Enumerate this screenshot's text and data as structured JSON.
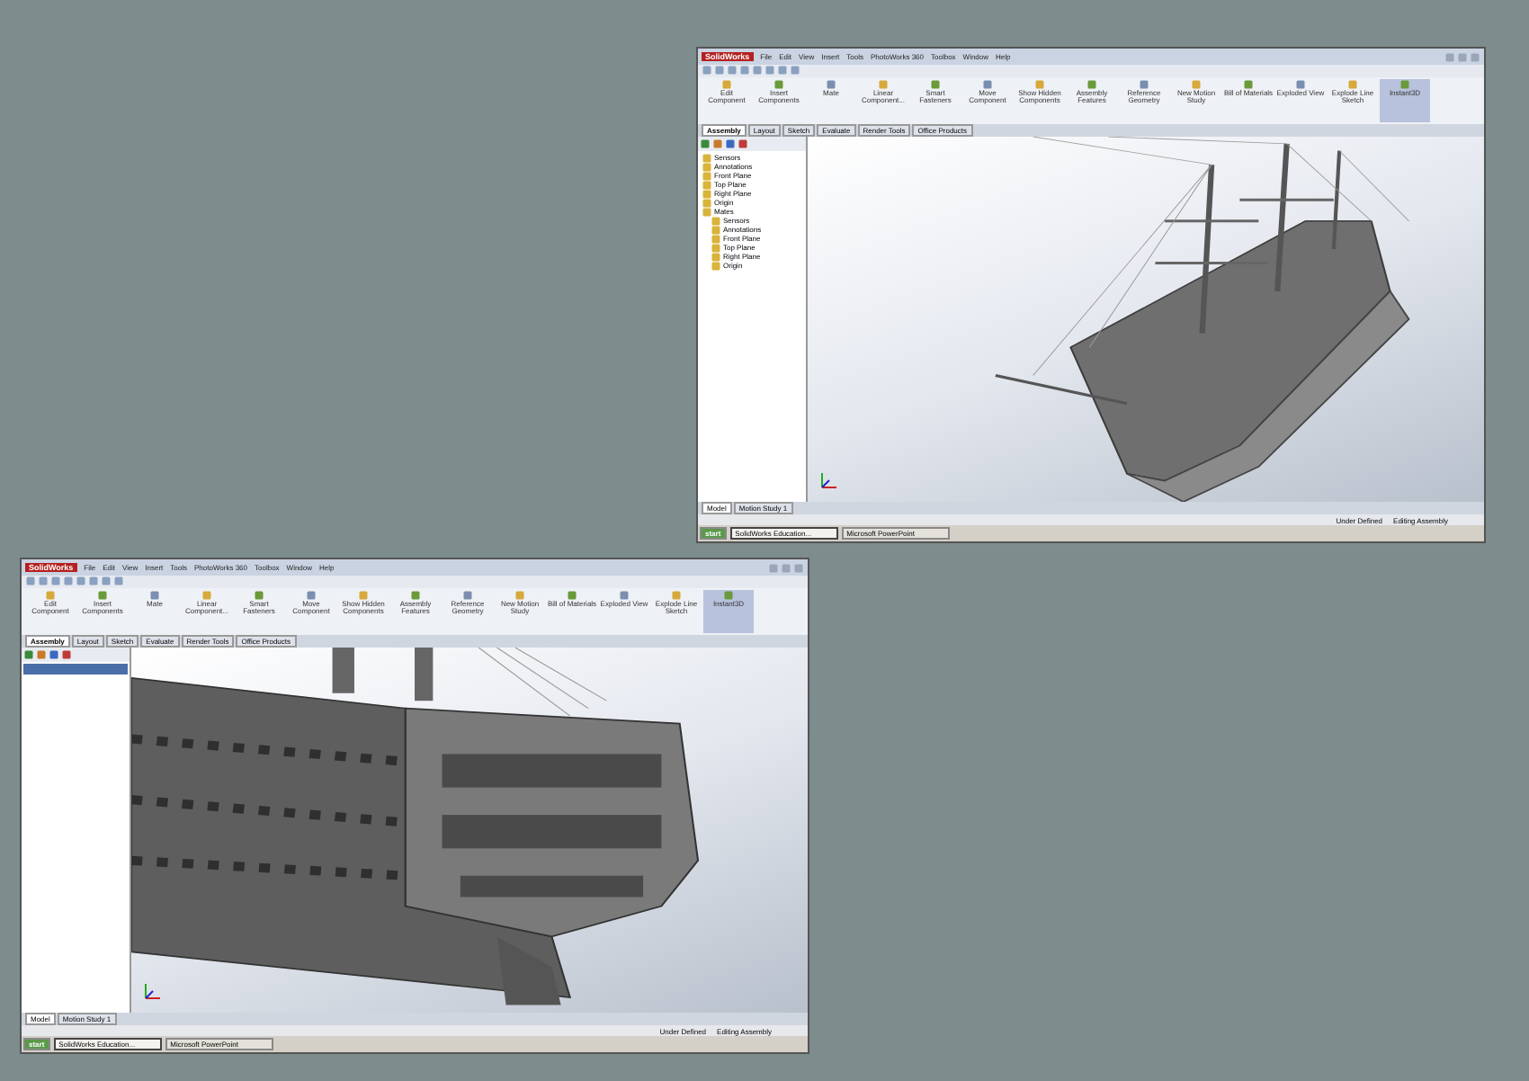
{
  "windows": [
    {
      "kind": "tree",
      "app": "SolidWorks",
      "menus": [
        "File",
        "Edit",
        "View",
        "Insert",
        "Tools",
        "PhotoWorks 360",
        "Toolbox",
        "Window",
        "Help"
      ],
      "commands": [
        "Edit Component",
        "Insert Components",
        "Mate",
        "Linear Component...",
        "Smart Fasteners",
        "Move Component",
        "Show Hidden Components",
        "Assembly Features",
        "Reference Geometry",
        "New Motion Study",
        "Bill of Materials",
        "Exploded View",
        "Explode Line Sketch",
        "Instant3D"
      ],
      "command_tabs": [
        {
          "label": "Assembly",
          "selected": true
        },
        {
          "label": "Layout",
          "selected": false
        },
        {
          "label": "Sketch",
          "selected": false
        },
        {
          "label": "Evaluate",
          "selected": false
        },
        {
          "label": "Render Tools",
          "selected": false
        },
        {
          "label": "Office Products",
          "selected": false
        }
      ],
      "tree": [
        {
          "label": "Sensors"
        },
        {
          "label": "Annotations"
        },
        {
          "label": "Front Plane"
        },
        {
          "label": "Top Plane"
        },
        {
          "label": "Right Plane"
        },
        {
          "label": "Origin"
        },
        {
          "label": "Mates",
          "children": [
            {
              "label": "Sensors"
            },
            {
              "label": "Annotations"
            },
            {
              "label": "Front Plane"
            },
            {
              "label": "Top Plane"
            },
            {
              "label": "Right Plane"
            },
            {
              "label": "Origin"
            }
          ]
        }
      ],
      "bottom_tabs": [
        {
          "label": "Model",
          "selected": true
        },
        {
          "label": "Motion Study 1",
          "selected": false
        }
      ],
      "status": [
        "Under Defined",
        "Editing Assembly"
      ],
      "start": "start",
      "taskbar": [
        {
          "label": "SolidWorks Education...",
          "selected": true
        },
        {
          "label": "Microsoft PowerPoint",
          "selected": false
        }
      ]
    },
    {
      "kind": "property",
      "app": "SolidWorks",
      "menus": [
        "File",
        "Edit",
        "View",
        "Insert",
        "Tools",
        "PhotoWorks 360",
        "Toolbox",
        "Window",
        "Help"
      ],
      "commands": [
        "Edit Component",
        "Insert Components",
        "Mate",
        "Linear Component...",
        "Smart Fasteners",
        "Move Component",
        "Show Hidden Components",
        "Assembly Features",
        "Reference Geometry",
        "New Motion Study",
        "Bill of Materials",
        "Exploded View",
        "Explode Line Sketch",
        "Instant3D"
      ],
      "command_tabs": [
        {
          "label": "Assembly",
          "selected": true
        },
        {
          "label": "Layout",
          "selected": false
        },
        {
          "label": "Sketch",
          "selected": false
        },
        {
          "label": "Evaluate",
          "selected": false
        },
        {
          "label": "Render Tools",
          "selected": false
        },
        {
          "label": "Office Products",
          "selected": false
        }
      ],
      "bottom_tabs": [
        {
          "label": "Model",
          "selected": true
        },
        {
          "label": "Motion Study 1",
          "selected": false
        }
      ],
      "status": [
        "Under Defined",
        "Editing Assembly"
      ],
      "start": "start",
      "taskbar": [
        {
          "label": "SolidWorks Education...",
          "selected": true
        },
        {
          "label": "Microsoft PowerPoint",
          "selected": false
        }
      ]
    }
  ]
}
